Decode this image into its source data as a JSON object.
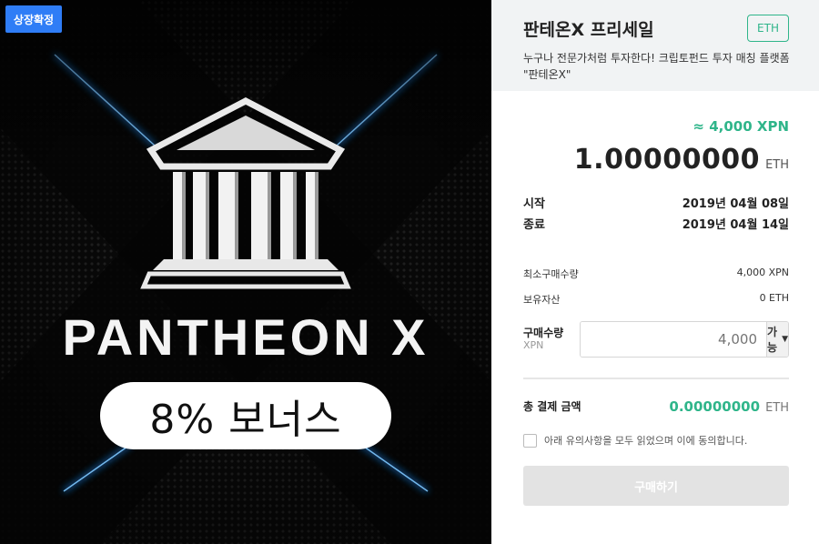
{
  "banner": {
    "tag": "상장확정",
    "brand": "PANTHEON X",
    "bonus": "8% 보너스"
  },
  "header": {
    "title": "판테온X 프리세일",
    "currency_badge": "ETH",
    "description": "누구나 전문가처럼 투자한다! 크립토펀드 투자 매칭 플랫폼 \"판테온X\""
  },
  "price": {
    "xpn_approx": "≈ 4,000 XPN",
    "amount": "1.00000000",
    "amount_unit": "ETH"
  },
  "schedule": {
    "start_label": "시작",
    "start_date": "2019년 04월 08일",
    "end_label": "종료",
    "end_date": "2019년 04월 14일"
  },
  "info": {
    "min_label": "최소구매수량",
    "min_value": "4,000 XPN",
    "holding_label": "보유자산",
    "holding_value": "0 ETH"
  },
  "quantity": {
    "label": "구매수량",
    "sub_label": "XPN",
    "placeholder": "4,000",
    "option_button": "가능"
  },
  "total": {
    "label": "총 결제 금액",
    "value": "0.00000000",
    "unit": "ETH"
  },
  "agreement": {
    "text": "아래 유의사항을 모두 읽었으며 이에 동의합니다."
  },
  "buy_button": "구매하기",
  "colors": {
    "accent_green": "#2fb58a",
    "tag_blue": "#2f7df6",
    "glow_blue": "#1e90ff"
  }
}
